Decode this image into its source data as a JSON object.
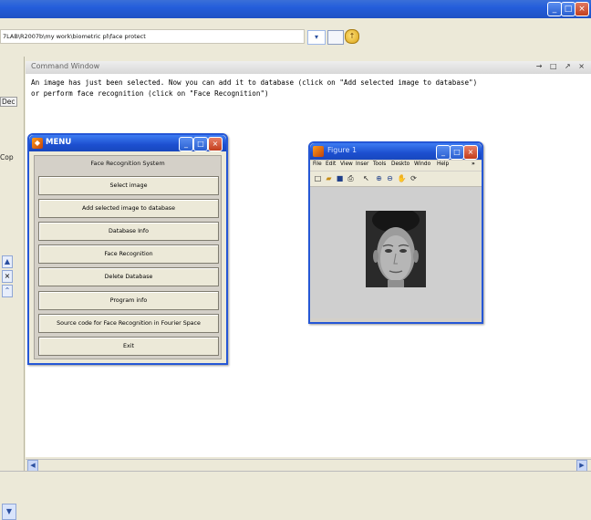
{
  "address": {
    "path": "7LAB\\R2007b\\my work\\biometric pl\\face protect"
  },
  "left_panel": {
    "label1": "Dec",
    "label2": "Cop",
    "btn_x": "×"
  },
  "command_window": {
    "title": "Command Window",
    "controls": "→ □ ↗ ×",
    "lines": [
      "An image has just been selected. Now you can add it to database (click on \"Add selected image to database\")",
      "or perform face recognition (click on \"Face Recognition\")"
    ]
  },
  "menu_window": {
    "title": "MENU",
    "heading": "Face Recognition System",
    "buttons": [
      "Select image",
      "Add selected image to database",
      "Database Info",
      "Face Recognition",
      "Delete Database",
      "Program info",
      "Source code for Face Recognition in Fourier Space",
      "Exit"
    ]
  },
  "figure_window": {
    "title": "Figure 1",
    "menu": [
      "File",
      "Edit",
      "View",
      "Inser",
      "Tools",
      "Deskto",
      "Windo",
      "Help",
      "»"
    ]
  },
  "colors": {
    "xp_blue": "#245edb",
    "close_red": "#c2401f",
    "matlab_orange": "#e07b10"
  }
}
